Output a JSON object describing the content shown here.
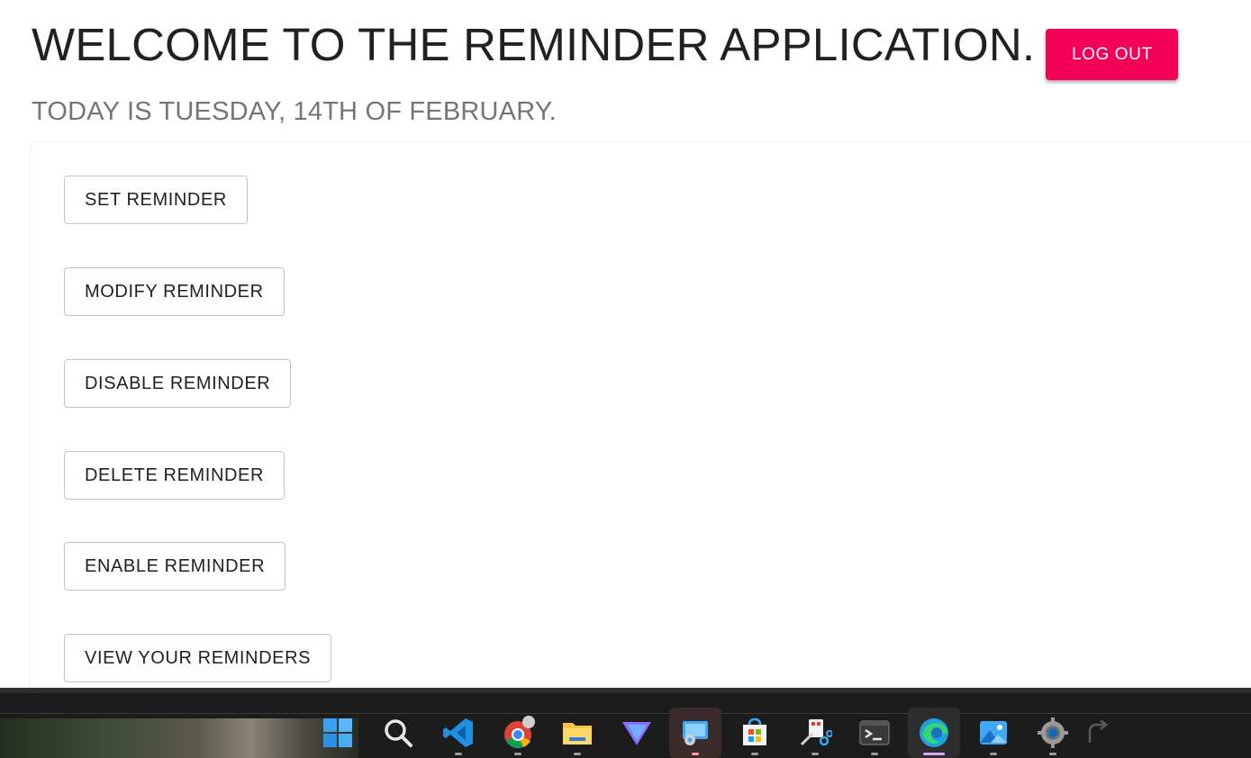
{
  "header": {
    "welcome_text": "WELCOME TO THE REMINDER APPLICATION.",
    "logout_label": "LOG OUT",
    "today_text": "TODAY IS TUESDAY, 14TH OF FEBRUARY."
  },
  "actions": {
    "set": "SET REMINDER",
    "modify": "MODIFY REMINDER",
    "disable": "DISABLE REMINDER",
    "delete": "DELETE REMINDER",
    "enable": "ENABLE REMINDER",
    "view": "VIEW YOUR REMINDERS"
  },
  "colors": {
    "accent": "#f50057",
    "title": "#212121",
    "subtitle": "#757575"
  },
  "taskbar": {
    "icons": [
      "windows-start-icon",
      "search-icon",
      "vscode-icon",
      "chrome-icon",
      "file-explorer-icon",
      "proton-vpn-icon",
      "remote-desktop-icon",
      "microsoft-store-icon",
      "snipping-tool-icon",
      "terminal-icon",
      "edge-icon",
      "photos-icon",
      "settings-icon",
      "redo-icon"
    ]
  }
}
